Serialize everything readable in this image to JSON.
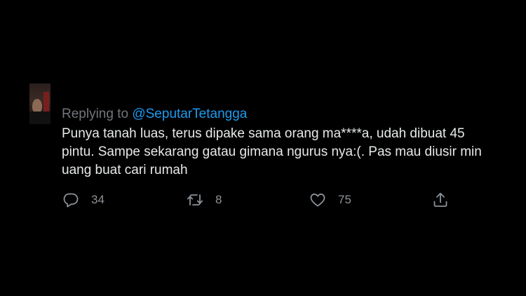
{
  "reply": {
    "prefix": "Replying to ",
    "handle": "@SeputarTetangga"
  },
  "tweet": {
    "lines": [
      "Punya tanah luas, terus dipake sama orang ma****a, udah dibuat 45",
      "pintu. Sampe sekarang gatau gimana ngurus nya:(. Pas mau diusir min",
      "uang buat cari rumah"
    ]
  },
  "actions": {
    "reply": {
      "icon": "reply-icon",
      "count": "34"
    },
    "retweet": {
      "icon": "retweet-icon",
      "count": "8"
    },
    "like": {
      "icon": "heart-icon",
      "count": "75"
    },
    "share": {
      "icon": "share-icon"
    }
  },
  "colors": {
    "background": "#000000",
    "text": "#e7e9ea",
    "muted": "#71767b",
    "link": "#1d9bf0"
  }
}
